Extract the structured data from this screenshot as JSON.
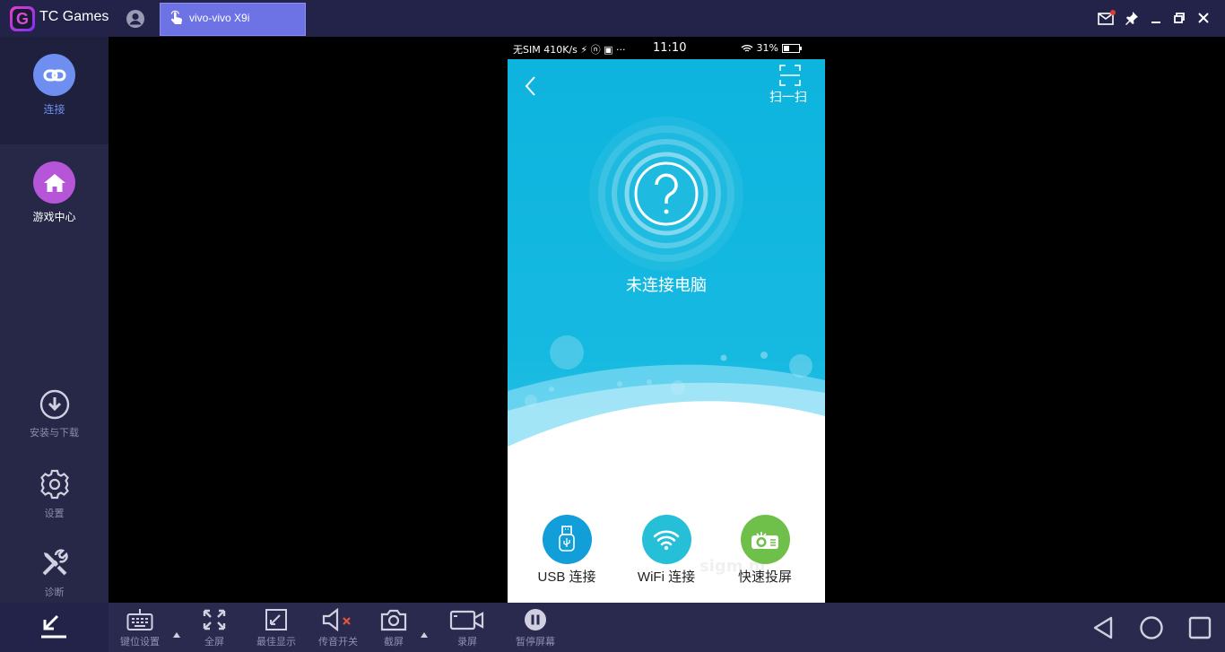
{
  "titlebar": {
    "app_title": "TC Games",
    "device_tab": "vivo-vivo X9i"
  },
  "sidebar": {
    "items": [
      {
        "label": "连接",
        "icon": "link-icon",
        "color": "#6e8ff0",
        "active": true
      },
      {
        "label": "游戏中心",
        "icon": "home-icon",
        "color": "#b755d8"
      },
      {
        "label": "安装与下载",
        "icon": "download-icon"
      },
      {
        "label": "设置",
        "icon": "gear-icon"
      },
      {
        "label": "诊断",
        "icon": "tools-icon"
      }
    ]
  },
  "phone": {
    "status_left": "无SIM 410K/s ⚡ ⓝ ▣ ···",
    "time": "11:10",
    "battery": "31%",
    "scan_label": "扫一扫",
    "connection_status": "未连接电脑",
    "buttons": [
      {
        "label": "USB 连接",
        "icon": "usb-icon",
        "color": "#129ed8"
      },
      {
        "label": "WiFi 连接",
        "icon": "wifi-icon",
        "color": "#25c0d8"
      },
      {
        "label": "快速投屏",
        "icon": "projector-icon",
        "color": "#6fc04a"
      }
    ],
    "watermark": "sigm     m"
  },
  "toolbar": {
    "items": [
      {
        "label": "键位设置",
        "icon": "keyboard-icon"
      },
      {
        "label": "全屏",
        "icon": "fullscreen-icon"
      },
      {
        "label": "最佳显示",
        "icon": "best-display-icon"
      },
      {
        "label": "传音开关",
        "icon": "mute-icon"
      },
      {
        "label": "截屏",
        "icon": "camera-icon"
      },
      {
        "label": "录屏",
        "icon": "video-icon"
      },
      {
        "label": "暂停屏幕",
        "icon": "pause-icon"
      }
    ]
  },
  "colors": {
    "titlebar_bg": "#23234a",
    "sidebar_bg": "#272748",
    "tab_bg": "#6d73e4",
    "screen_blue": "#0db4de"
  }
}
